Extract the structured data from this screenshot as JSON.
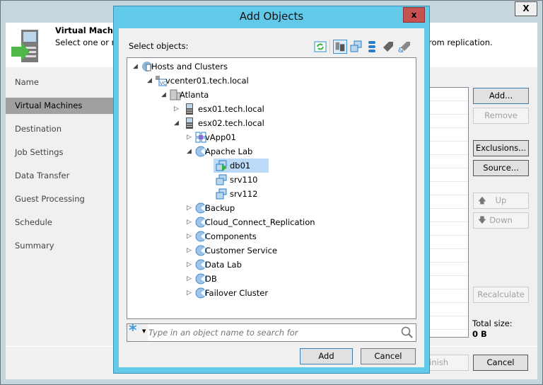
{
  "wizard": {
    "close_label": "X",
    "header_title": "Virtual Machines",
    "header_desc_left": "Select one or m",
    "header_desc_right": "rom replication.",
    "steps": [
      "Name",
      "Virtual Machines",
      "Destination",
      "Job Settings",
      "Data Transfer",
      "Guest Processing",
      "Schedule",
      "Summary"
    ],
    "buttons": {
      "add": "Add...",
      "remove": "Remove",
      "exclusions": "Exclusions...",
      "source": "Source...",
      "up": "Up",
      "down": "Down",
      "recalculate": "Recalculate",
      "finish": "Finish",
      "cancel": "Cancel"
    },
    "total_size_label": "Total size:",
    "total_size_value": "0 B"
  },
  "dialog": {
    "title": "Add Objects",
    "close_label": "x",
    "select_label": "Select objects:",
    "tree": [
      {
        "label": "Hosts and Clusters",
        "level": 0,
        "icon": "globe-icon",
        "exp": "open"
      },
      {
        "label": "vcenter01.tech.local",
        "level": 1,
        "icon": "vcenter-icon",
        "exp": "open"
      },
      {
        "label": "Atlanta",
        "level": 2,
        "icon": "datacenter-icon",
        "exp": "open"
      },
      {
        "label": "esx01.tech.local",
        "level": 3,
        "icon": "host-icon",
        "exp": "closed"
      },
      {
        "label": "esx02.tech.local",
        "level": 3,
        "icon": "host-icon",
        "exp": "open"
      },
      {
        "label": "vApp01",
        "level": 4,
        "icon": "vapp-icon",
        "exp": "closed"
      },
      {
        "label": "Apache Lab",
        "level": 4,
        "icon": "resource-pool-icon",
        "exp": "open"
      },
      {
        "label": "db01",
        "level": 5,
        "icon": "vm-running-icon",
        "exp": "",
        "selected": true
      },
      {
        "label": "srv110",
        "level": 5,
        "icon": "vm-icon",
        "exp": ""
      },
      {
        "label": "srv112",
        "level": 5,
        "icon": "vm-icon",
        "exp": ""
      },
      {
        "label": "Backup",
        "level": 4,
        "icon": "resource-pool-icon",
        "exp": "closed"
      },
      {
        "label": "Cloud_Connect_Replication",
        "level": 4,
        "icon": "resource-pool-icon",
        "exp": "closed"
      },
      {
        "label": "Components",
        "level": 4,
        "icon": "resource-pool-icon",
        "exp": "closed"
      },
      {
        "label": "Customer Service",
        "level": 4,
        "icon": "resource-pool-icon",
        "exp": "closed"
      },
      {
        "label": "Data Lab",
        "level": 4,
        "icon": "resource-pool-icon",
        "exp": "closed"
      },
      {
        "label": "DB",
        "level": 4,
        "icon": "resource-pool-icon",
        "exp": "closed"
      },
      {
        "label": "Failover Cluster",
        "level": 4,
        "icon": "resource-pool-icon",
        "exp": "closed"
      }
    ],
    "search_placeholder": "Type in an object name to search for",
    "add_label": "Add",
    "cancel_label": "Cancel"
  },
  "colors": {
    "dialog_frame": "#62c9e9",
    "close_red": "#c75050",
    "selection": "#bbdaf8"
  }
}
